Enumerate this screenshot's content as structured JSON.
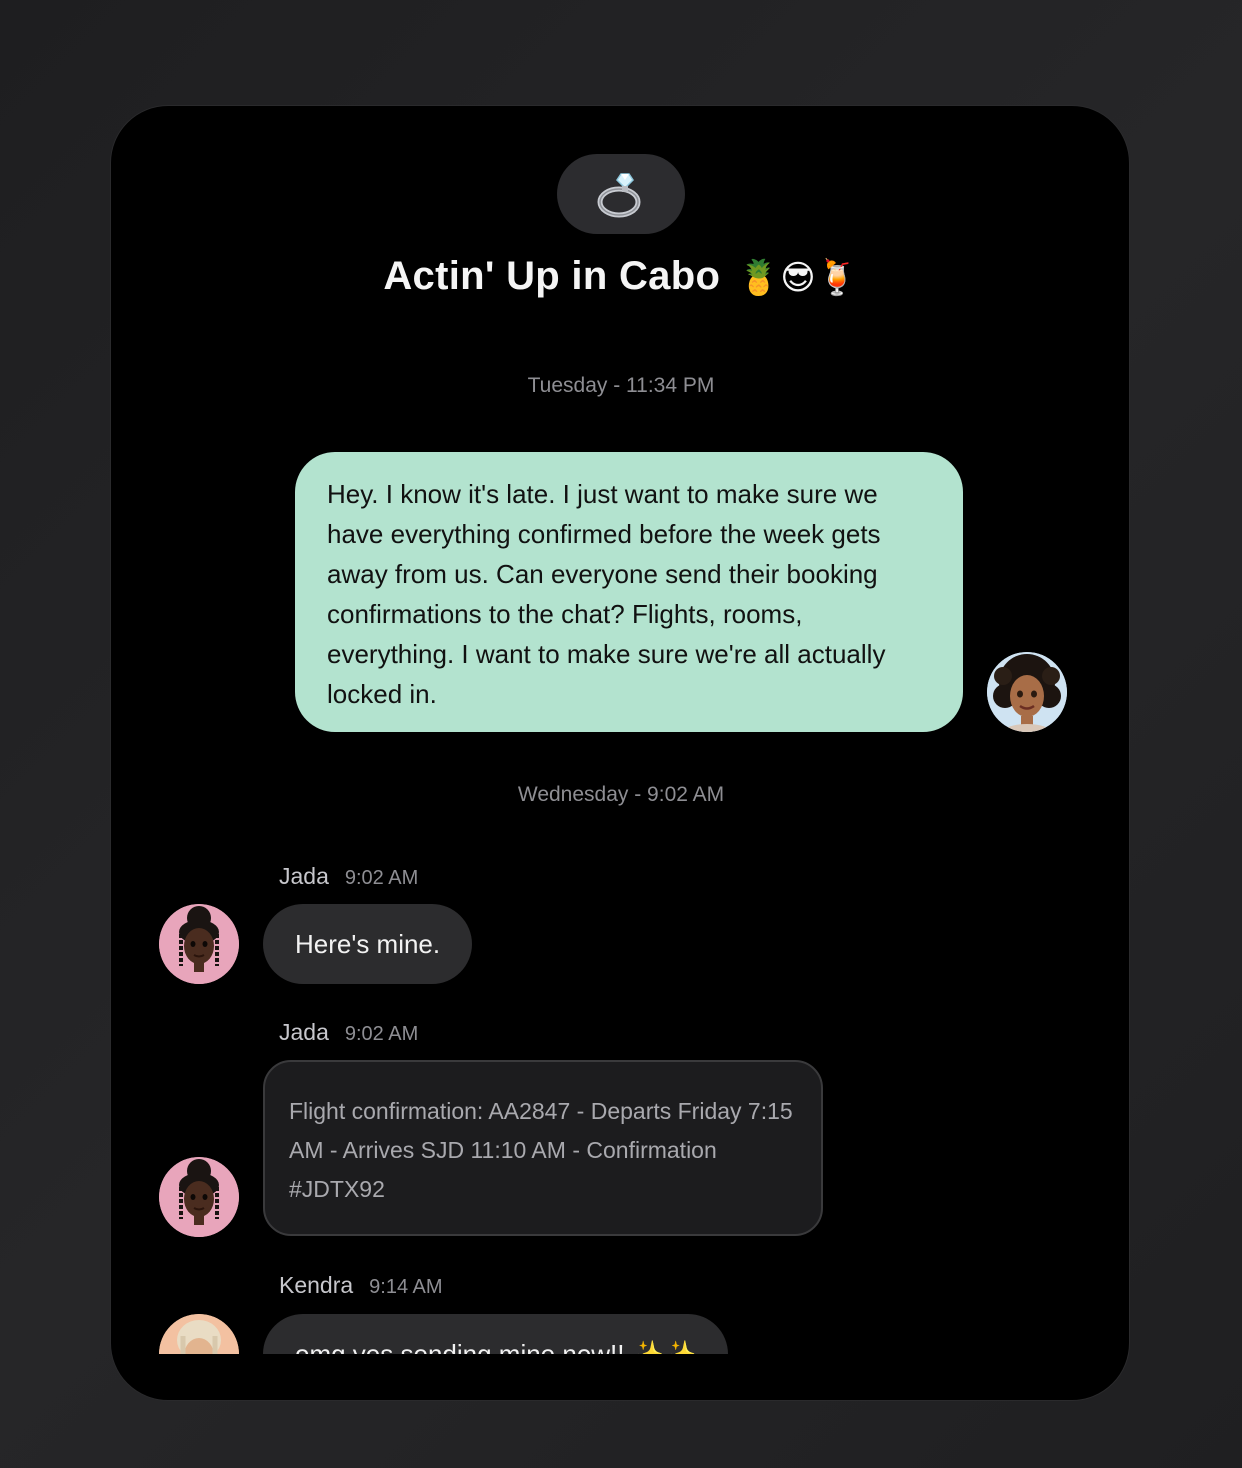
{
  "group": {
    "icon": "ring-icon",
    "title": "Actin' Up in Cabo",
    "title_emoji": "🍍😎🍹"
  },
  "conversation": {
    "day1_timestamp": "Tuesday - 11:34 PM",
    "outgoing_message": "Hey. I know it's late. I just want to make sure we have everything confirmed before the week gets away from us. Can everyone send their booking confirmations to the chat? Flights, rooms, everything. I want to make sure we're all actually locked in.",
    "day2_timestamp": "Wednesday - 9:02 AM",
    "messages": [
      {
        "sender": "Jada",
        "time": "9:02 AM",
        "text": "Here's mine."
      },
      {
        "sender": "Jada",
        "time": "9:02 AM",
        "text": "Flight confirmation: AA2847 - Departs Friday 7:15 AM - Arrives SJD 11:10 AM - Confirmation #JDTX92"
      },
      {
        "sender": "Kendra",
        "time": "9:14 AM",
        "text": "omg yes sending mine now!! ✨✨"
      }
    ]
  },
  "colors": {
    "outgoing_bubble": "#b3e3cf",
    "incoming_bubble": "#2c2c2e",
    "background": "#000000",
    "jada_avatar_bg": "#e8a5bb",
    "kendra_avatar_bg": "#f3c1a1",
    "me_avatar_bg": "#cfe3f2"
  }
}
